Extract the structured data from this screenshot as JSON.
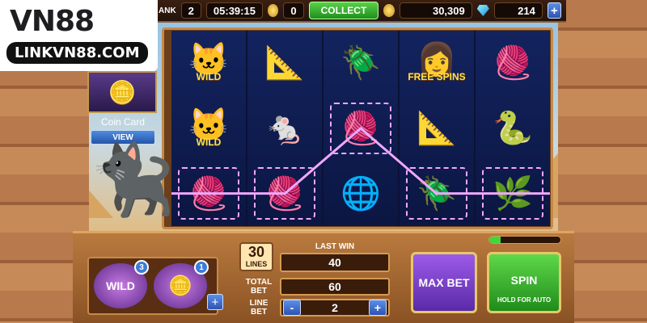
{
  "topbar": {
    "rank_label": "ANK",
    "rank_value": "2",
    "timer": "05:39:15",
    "collect_count": "0",
    "collect_label": "COLLECT",
    "coins": "30,309",
    "gems": "214"
  },
  "logo": {
    "top": "VN88",
    "bottom": "LINKVN88.COM"
  },
  "coin_card": {
    "title": "Coin Card",
    "view_label": "VIEW"
  },
  "reels": [
    [
      {
        "icon": "🐱",
        "label": "WILD"
      },
      {
        "icon": "🐱",
        "label": "WILD"
      },
      {
        "icon": "🧶",
        "label": ""
      }
    ],
    [
      {
        "icon": "📐",
        "label": ""
      },
      {
        "icon": "🐁",
        "label": ""
      },
      {
        "icon": "🧶",
        "label": ""
      }
    ],
    [
      {
        "icon": "🪲",
        "label": ""
      },
      {
        "icon": "🧶",
        "label": ""
      },
      {
        "icon": "🌐",
        "label": ""
      }
    ],
    [
      {
        "icon": "👩",
        "label": "FREE SPINS"
      },
      {
        "icon": "📐",
        "label": ""
      },
      {
        "icon": "🪲",
        "label": ""
      }
    ],
    [
      {
        "icon": "🧶",
        "label": ""
      },
      {
        "icon": "🐍",
        "label": ""
      },
      {
        "icon": "🌿",
        "label": ""
      }
    ]
  ],
  "win_line": [
    [
      0,
      2
    ],
    [
      1,
      2
    ],
    [
      2,
      1
    ],
    [
      3,
      2
    ],
    [
      4,
      2
    ]
  ],
  "boosters": [
    {
      "label": "WILD",
      "count": "3"
    },
    {
      "label": "🪙",
      "count": "1"
    }
  ],
  "lines": {
    "value": "30",
    "label": "LINES"
  },
  "last_win": {
    "label": "LAST WIN",
    "value": "40"
  },
  "total_bet": {
    "label": "TOTAL BET",
    "value": "60"
  },
  "line_bet": {
    "label": "LINE BET",
    "value": "2",
    "minus": "-",
    "plus": "+"
  },
  "max_bet_label": "MAX BET",
  "spin": {
    "label": "SPIN",
    "hint": "HOLD FOR AUTO"
  },
  "plus_symbol": "+",
  "progress_fraction": 0.16
}
